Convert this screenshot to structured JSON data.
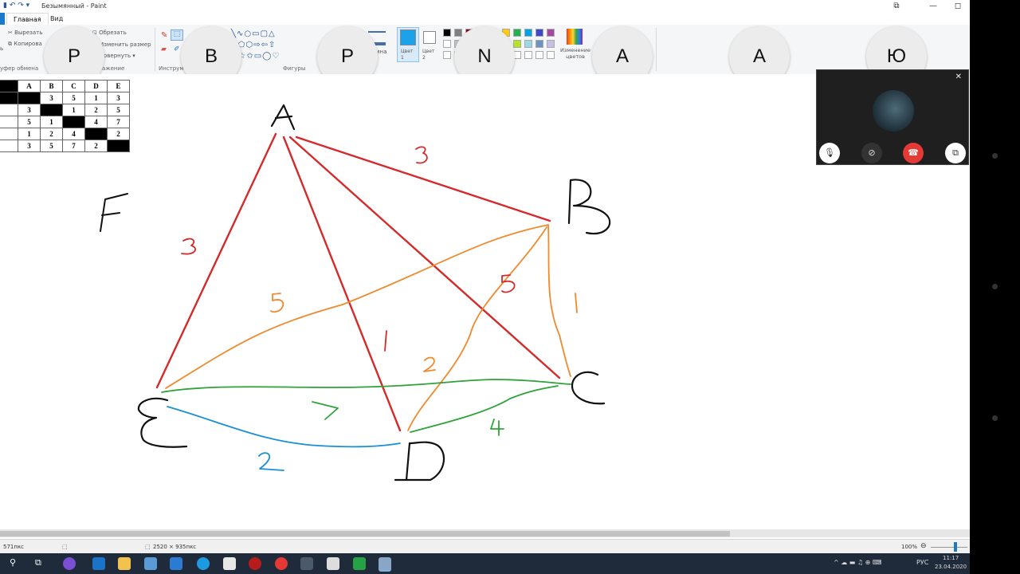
{
  "window": {
    "title": "Безымянный - Paint",
    "controls": [
      "⧉",
      "—",
      "◻"
    ]
  },
  "tabs": [
    {
      "label": "Главная"
    },
    {
      "label": "Вид"
    }
  ],
  "ribbon": {
    "clipboard": {
      "paste_partial": "ь",
      "cut": "Вырезать",
      "copy": "Копирова",
      "group_label": "уфер обмена"
    },
    "image": {
      "crop": "Обрезать",
      "resize": "Изменить размер",
      "rotate": "овернуть ▾",
      "group_label": "ажение"
    },
    "tools": {
      "group_label": "Инструм"
    },
    "shapes": {
      "group_label": "Фигуры",
      "size_label": "ина"
    },
    "colors": {
      "color1_label": "Цвет 1",
      "color2_label": "Цвет 2",
      "edit_colors": "Изменение цветов",
      "color1": "#1ca2ea",
      "color2": "#ffffff"
    }
  },
  "participants": [
    "P",
    "B",
    "P",
    "N",
    "A",
    "A",
    "Ю"
  ],
  "matrix": {
    "headers": [
      "",
      "A",
      "B",
      "C",
      "D",
      "E"
    ],
    "rows": [
      [
        "",
        "",
        "3",
        "5",
        "1",
        "3"
      ],
      [
        "",
        "3",
        "",
        "1",
        "2",
        "5"
      ],
      [
        "",
        "5",
        "1",
        "",
        "4",
        "7"
      ],
      [
        "",
        "1",
        "2",
        "4",
        "",
        "2"
      ],
      [
        "",
        "3",
        "5",
        "7",
        "2",
        ""
      ]
    ]
  },
  "drawing": {
    "vertex_labels": [
      "A",
      "B",
      "C",
      "D",
      "E",
      "F"
    ],
    "edge_weights": [
      {
        "label": "3",
        "color": "#d42a2a"
      },
      {
        "label": "3",
        "color": "#d42a2a"
      },
      {
        "label": "1",
        "color": "#d42a2a"
      },
      {
        "label": "5",
        "color": "#d42a2a"
      },
      {
        "label": "5",
        "color": "#ef8a2e"
      },
      {
        "label": "1",
        "color": "#ef8a2e"
      },
      {
        "label": "2",
        "color": "#ef8a2e"
      },
      {
        "label": "7",
        "color": "#2ea33a"
      },
      {
        "label": "4",
        "color": "#2ea33a"
      },
      {
        "label": "2",
        "color": "#1a8fd6"
      }
    ]
  },
  "statusbar": {
    "cursor": "571пкс",
    "dimensions": "2520 × 935пкс",
    "zoom": "100%"
  },
  "taskbar": {
    "lang": "РУС",
    "time": "11:17",
    "date": "23.04.2020"
  },
  "colors": {
    "red": "#d42a2a",
    "orange": "#ef8a2e",
    "green": "#2ea33a",
    "blue": "#1a8fd6",
    "taskbar": "#1f2a3a",
    "hangup": "#e53935"
  }
}
